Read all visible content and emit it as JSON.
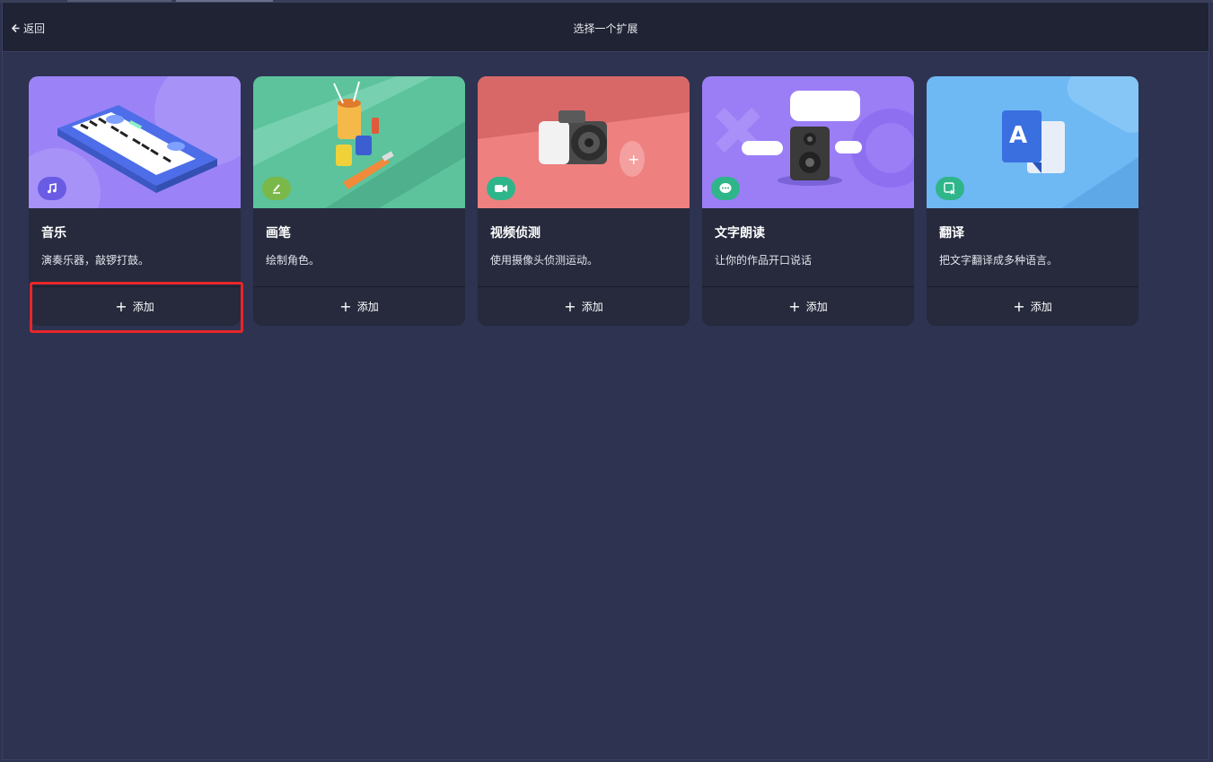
{
  "header": {
    "back_label": "返回",
    "title": "选择一个扩展"
  },
  "extensions": [
    {
      "name": "音乐",
      "description": "演奏乐器，敲锣打鼓。",
      "add_label": "添加",
      "icon": "music-note-icon",
      "art_color": "#9b82f7",
      "badge_color": "#6a5be5"
    },
    {
      "name": "画笔",
      "description": "绘制角色。",
      "add_label": "添加",
      "icon": "pen-icon",
      "art_color": "#5cc39d",
      "badge_color": "#7ab84a"
    },
    {
      "name": "视频侦测",
      "description": "使用摄像头侦测运动。",
      "add_label": "添加",
      "icon": "video-camera-icon",
      "art_color": "#ee8080",
      "badge_color": "#2fb58a"
    },
    {
      "name": "文字朗读",
      "description": "让你的作品开口说话",
      "add_label": "添加",
      "icon": "speech-bubble-icon",
      "art_color": "#9b7ef6",
      "badge_color": "#2fb58a"
    },
    {
      "name": "翻译",
      "description": "把文字翻译成多种语言。",
      "add_label": "添加",
      "icon": "translate-icon",
      "art_color": "#6eb8f4",
      "badge_color": "#2fb58a"
    }
  ],
  "colors": {
    "background": "#2d3350",
    "header": "#1f2333",
    "card": "#262a3c",
    "highlight": "#e8262a"
  }
}
